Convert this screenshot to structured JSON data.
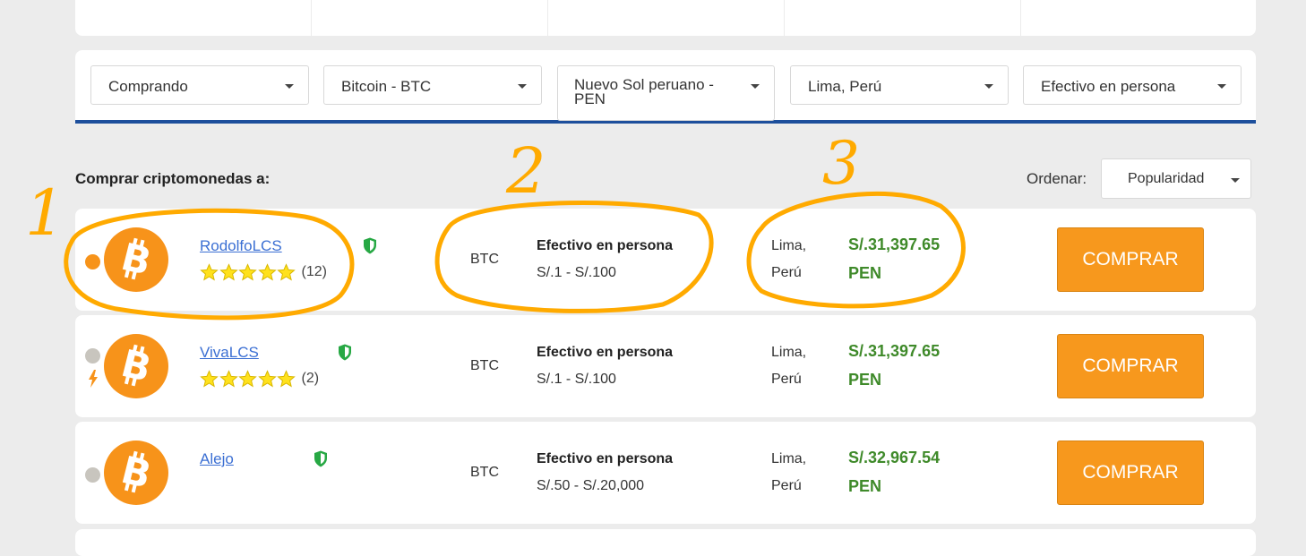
{
  "filters": {
    "action": "Comprando",
    "crypto": "Bitcoin - BTC",
    "currency": "Nuevo Sol peruano - PEN",
    "location": "Lima, Perú",
    "payment": "Efectivo en persona"
  },
  "section_title": "Comprar criptomonedas a:",
  "sort": {
    "label": "Ordenar:",
    "value": "Popularidad"
  },
  "offers": [
    {
      "user": "RodolfoLCS",
      "rating_stars": 5,
      "reviews": "(12)",
      "status_color": "#f7931a",
      "lightning": false,
      "crypto": "BTC",
      "method": "Efectivo en persona",
      "range": "S/.1 - S/.100",
      "loc_line1": "Lima,",
      "loc_line2": "Perú",
      "price": "S/.31,397.65",
      "currency": "PEN",
      "button": "COMPRAR"
    },
    {
      "user": "VivaLCS",
      "rating_stars": 5,
      "reviews": "(2)",
      "status_color": "#c8c5be",
      "lightning": true,
      "crypto": "BTC",
      "method": "Efectivo en persona",
      "range": "S/.1 - S/.100",
      "loc_line1": "Lima,",
      "loc_line2": "Perú",
      "price": "S/.31,397.65",
      "currency": "PEN",
      "button": "COMPRAR"
    },
    {
      "user": "Alejo",
      "rating_stars": 0,
      "reviews": "",
      "status_color": "#c8c5be",
      "lightning": false,
      "crypto": "BTC",
      "method": "Efectivo en persona",
      "range": "S/.50 - S/.20,000",
      "loc_line1": "Lima,",
      "loc_line2": "Perú",
      "price": "S/.32,967.54",
      "currency": "PEN",
      "button": "COMPRAR"
    }
  ],
  "annotations": {
    "one": "1",
    "two": "2",
    "three": "3"
  },
  "colors": {
    "accent": "#f7981d",
    "price_green": "#3f8a2a",
    "link_blue": "#3b6fd3",
    "bitcoin_orange": "#f7931a",
    "annotation": "#ffaa00",
    "filter_border": "#1d4f9c"
  }
}
